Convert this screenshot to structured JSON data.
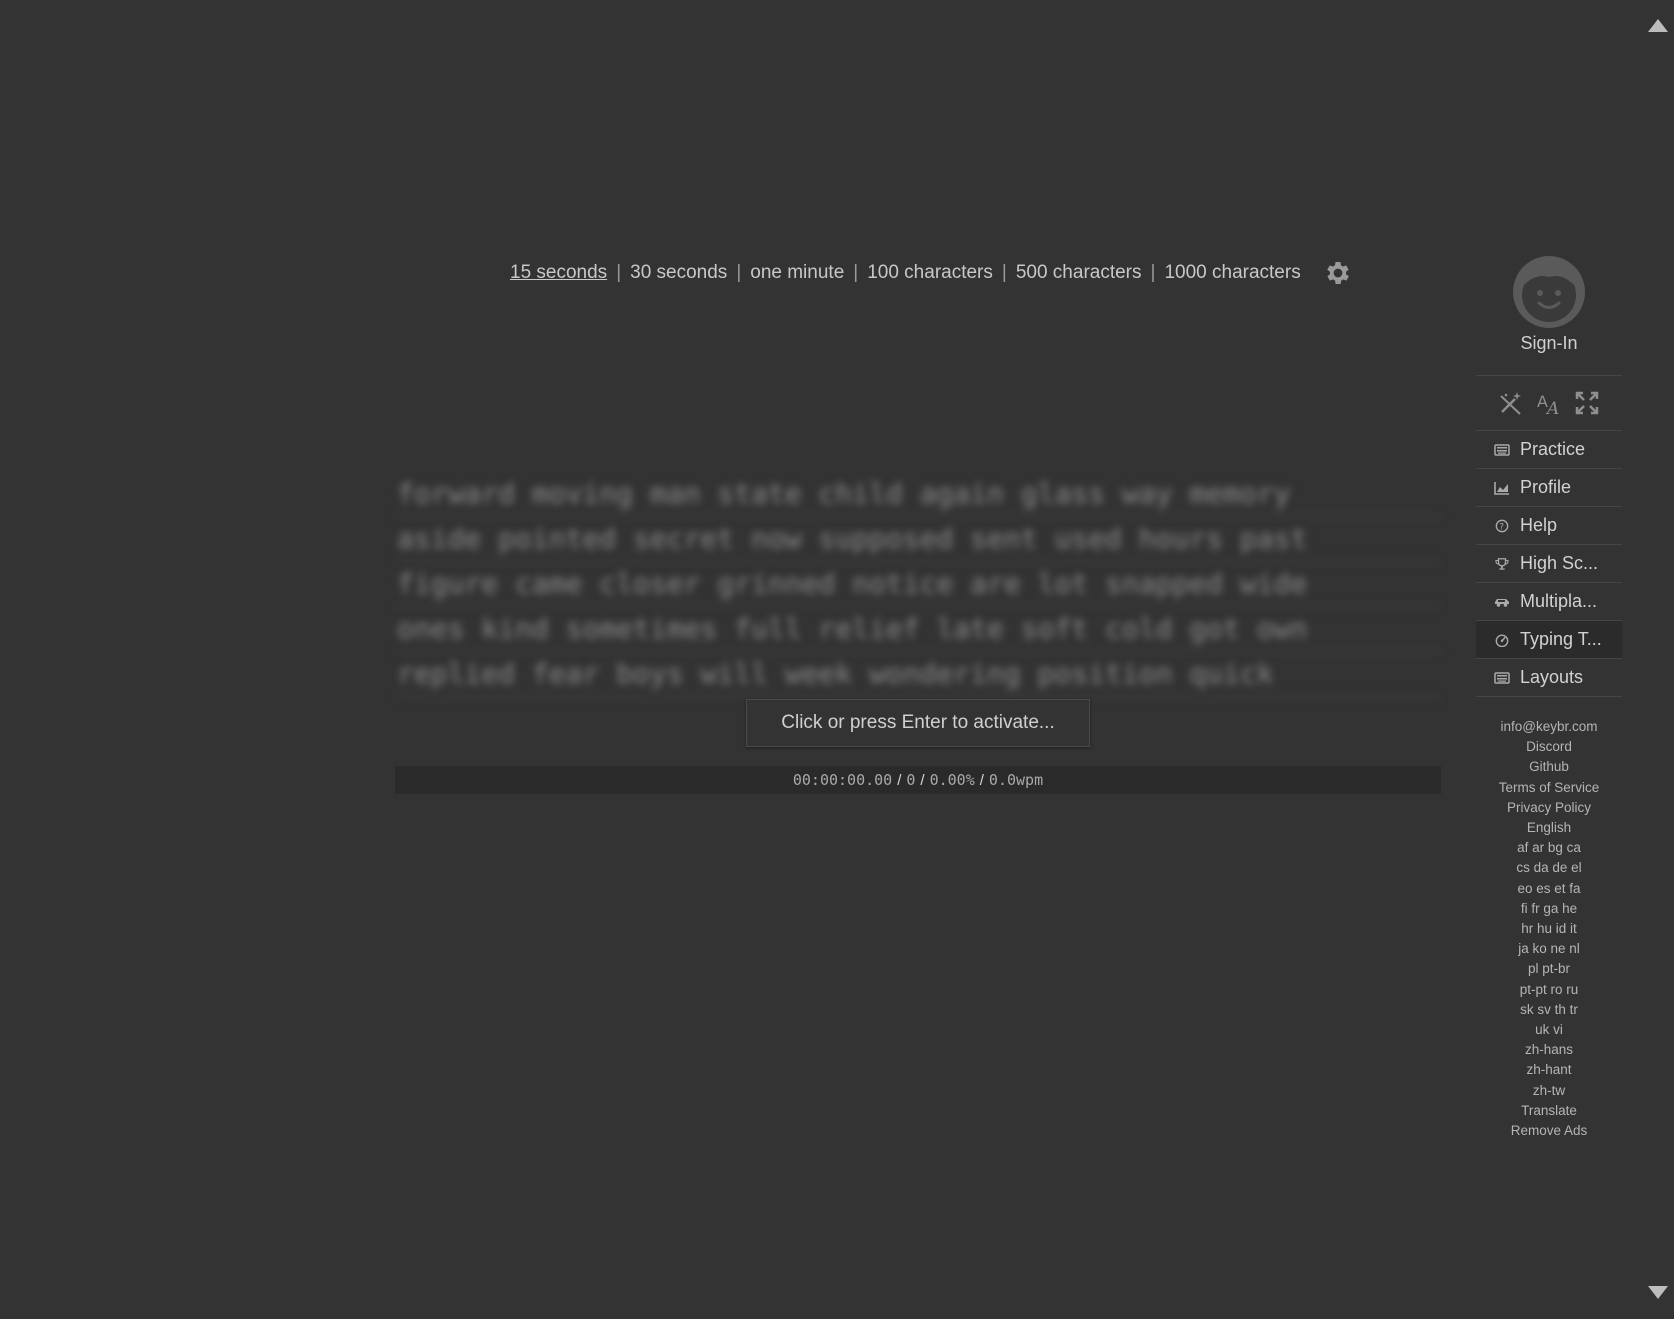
{
  "modes": {
    "items": [
      "15 seconds",
      "30 seconds",
      "one minute",
      "100 characters",
      "500 characters",
      "1000 characters"
    ],
    "active_index": 0,
    "separator": "|"
  },
  "text": {
    "lines": [
      "forward moving man state child again glass way memory",
      "aside pointed secret now supposed sent used hours past",
      "figure came closer grinned notice are lot snapped wide",
      "ones kind sometimes full relief late soft cold got own",
      "replied fear boys will week wondering position quick"
    ]
  },
  "activate_prompt": "Click or press Enter to activate...",
  "status": {
    "time": "00:00:00.00",
    "count": "0",
    "accuracy": "0.00%",
    "speed": "0.0wpm",
    "separator": "/"
  },
  "sidebar": {
    "signin_label": "Sign-In",
    "nav": [
      {
        "label": "Practice",
        "icon": "keyboard-icon"
      },
      {
        "label": "Profile",
        "icon": "chart-icon"
      },
      {
        "label": "Help",
        "icon": "help-icon"
      },
      {
        "label": "High Sc...",
        "icon": "trophy-icon"
      },
      {
        "label": "Multipla...",
        "icon": "car-icon"
      },
      {
        "label": "Typing T...",
        "icon": "speedometer-icon"
      },
      {
        "label": "Layouts",
        "icon": "keyboard-icon"
      }
    ],
    "active_nav_index": 5,
    "links": [
      "info@keybr.com",
      "Discord",
      "Github",
      "Terms of Service",
      "Privacy Policy",
      "English",
      "af ar bg ca",
      "cs da de el",
      "eo es et fa",
      "fi fr ga he",
      "hr hu id it",
      "ja ko ne nl",
      "pl pt-br",
      "pt-pt ro ru",
      "sk sv th tr",
      "uk vi",
      "zh-hans",
      "zh-hant",
      "zh-tw",
      "Translate",
      "Remove Ads"
    ]
  },
  "colors": {
    "background": "#333333",
    "text": "#c8c8c8",
    "muted": "#8a8a8a"
  }
}
